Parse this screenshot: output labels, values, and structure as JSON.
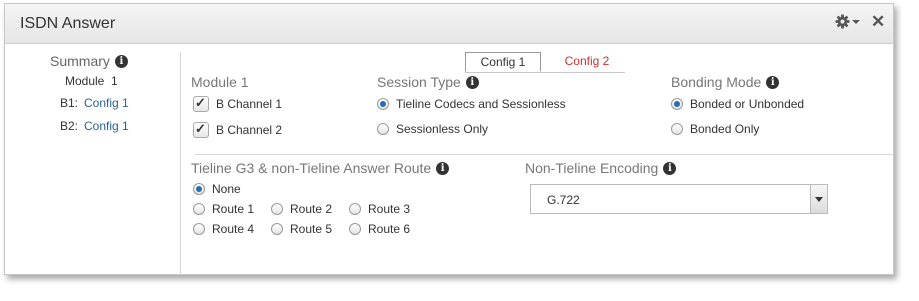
{
  "window": {
    "title": "ISDN Answer"
  },
  "summary": {
    "title": "Summary",
    "module": "Module  1",
    "rows": [
      {
        "label": "B1:",
        "value": "Config 1"
      },
      {
        "label": "B2:",
        "value": "Config 1"
      }
    ]
  },
  "tabs": [
    {
      "label": "Config 1",
      "active": true
    },
    {
      "label": "Config 2",
      "active": false
    }
  ],
  "module": {
    "label": "Module 1",
    "channels": [
      {
        "label": "B Channel 1",
        "checked": true
      },
      {
        "label": "B Channel 2",
        "checked": true
      }
    ]
  },
  "session_type": {
    "label": "Session Type",
    "options": [
      {
        "label": "Tieline Codecs and Sessionless",
        "checked": true
      },
      {
        "label": "Sessionless Only",
        "checked": false
      }
    ]
  },
  "bonding_mode": {
    "label": "Bonding Mode",
    "options": [
      {
        "label": "Bonded or Unbonded",
        "checked": true
      },
      {
        "label": "Bonded Only",
        "checked": false
      }
    ]
  },
  "answer_route": {
    "label": "Tieline G3 & non-Tieline Answer Route",
    "options": [
      {
        "label": "None",
        "checked": true
      },
      {
        "label": "Route 1",
        "checked": false
      },
      {
        "label": "Route 2",
        "checked": false
      },
      {
        "label": "Route 3",
        "checked": false
      },
      {
        "label": "Route 4",
        "checked": false
      },
      {
        "label": "Route 5",
        "checked": false
      },
      {
        "label": "Route 6",
        "checked": false
      }
    ]
  },
  "encoding": {
    "label": "Non-Tieline Encoding",
    "selected": "G.722"
  },
  "colors": {
    "accent": "#2a6496",
    "inactive_tab": "#d03030",
    "radio_dot": "#2a6cb0"
  }
}
